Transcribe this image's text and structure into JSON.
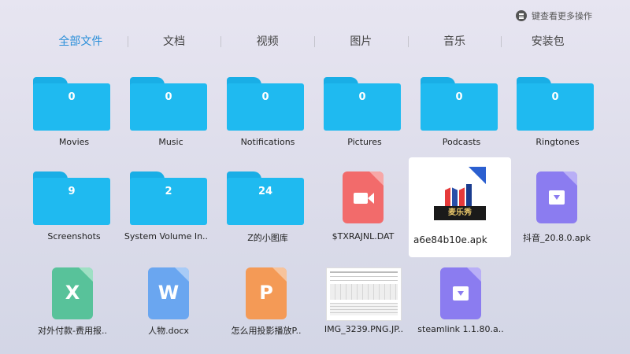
{
  "hint": {
    "text": "键查看更多操作",
    "icon": "menu-icon"
  },
  "tabs": [
    "全部文件",
    "文档",
    "视频",
    "图片",
    "音乐",
    "安装包"
  ],
  "active_tab_index": 0,
  "folders_row1": [
    {
      "name": "Movies",
      "count": "0"
    },
    {
      "name": "Music",
      "count": "0"
    },
    {
      "name": "Notifications",
      "count": "0"
    },
    {
      "name": "Pictures",
      "count": "0"
    },
    {
      "name": "Podcasts",
      "count": "0"
    },
    {
      "name": "Ringtones",
      "count": "0"
    }
  ],
  "folders_row2": [
    {
      "name": "Screenshots",
      "count": "9"
    },
    {
      "name": "System Volume In..",
      "count": "2"
    },
    {
      "name": "Z的小图库",
      "count": "24"
    }
  ],
  "files_row2": [
    {
      "name": "$TXRAJNL.DAT",
      "icon": "video-file-icon",
      "color": "#f26b6b"
    },
    {
      "name": "a6e84b10e.apk",
      "icon": "app-icon",
      "selected": true,
      "brand_text": "麦乐秀"
    },
    {
      "name": "抖音_20.8.0.apk",
      "icon": "apk-file-icon",
      "color": "#8b7cf0"
    }
  ],
  "files_row3": [
    {
      "name": "对外付款-费用报..",
      "icon": "excel-file-icon",
      "color": "#58c29a",
      "glyph": "X"
    },
    {
      "name": "人物.docx",
      "icon": "word-file-icon",
      "color": "#6aa6f0",
      "glyph": "W"
    },
    {
      "name": "怎么用投影播放P..",
      "icon": "ppt-file-icon",
      "color": "#f49a56",
      "glyph": "P"
    },
    {
      "name": "IMG_3239.PNG.JP..",
      "icon": "image-thumbnail"
    },
    {
      "name": "steamlink 1.1.80.a..",
      "icon": "apk-file-icon",
      "color": "#8b7cf0"
    }
  ]
}
